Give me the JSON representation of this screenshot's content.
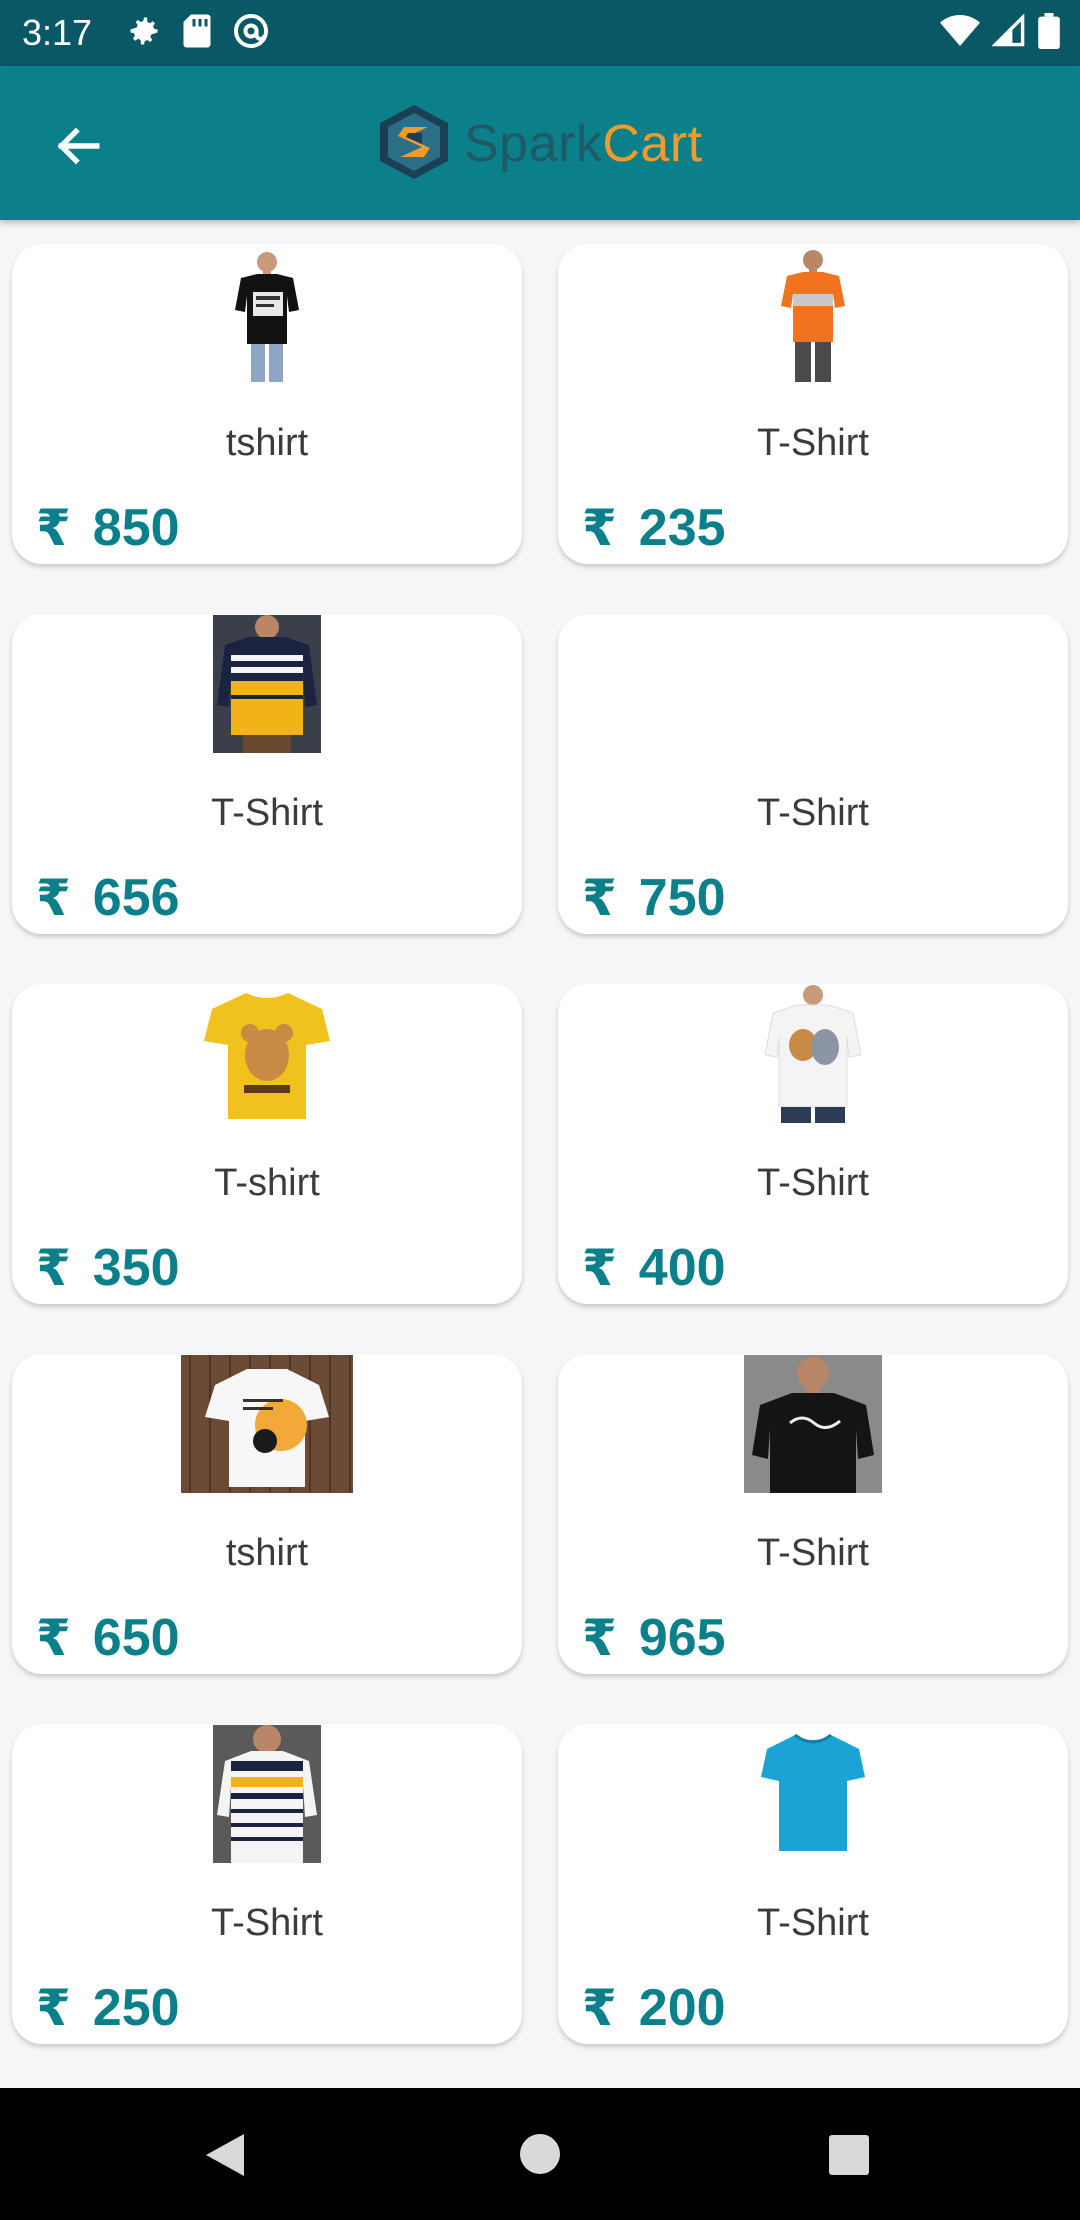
{
  "status_bar": {
    "time": "3:17",
    "left_icons": [
      "gear-icon",
      "sd-card-icon",
      "at-sign-icon"
    ],
    "right_icons": [
      "wifi-icon",
      "cell-signal-icon",
      "battery-icon"
    ]
  },
  "app_bar": {
    "back_icon": "arrow-left-icon",
    "logo_spark": "Spark",
    "logo_cart": "Cart",
    "colors": {
      "bar": "#0b7f8a",
      "status": "#0a5866",
      "spark": "#1e5a66",
      "cart": "#f29a2c"
    }
  },
  "currency_symbol": "₹",
  "products": [
    {
      "name": "tshirt",
      "price": "850",
      "image": "black-graphic-tshirt"
    },
    {
      "name": "T-Shirt",
      "price": "235",
      "image": "orange-grey-tshirt"
    },
    {
      "name": "T-Shirt",
      "price": "656",
      "image": "navy-yellow-striped-tshirt"
    },
    {
      "name": "T-Shirt",
      "price": "750",
      "image": ""
    },
    {
      "name": "T-shirt",
      "price": "350",
      "image": "yellow-jerry-tshirt"
    },
    {
      "name": "T-Shirt",
      "price": "400",
      "image": "white-tom-jerry-tshirt"
    },
    {
      "name": "tshirt",
      "price": "650",
      "image": "white-print-tshirt-on-wood"
    },
    {
      "name": "T-Shirt",
      "price": "965",
      "image": "black-script-tshirt"
    },
    {
      "name": "T-Shirt",
      "price": "250",
      "image": "white-navy-yellow-striped-polo"
    },
    {
      "name": "T-Shirt",
      "price": "200",
      "image": "blue-plain-tshirt"
    }
  ],
  "nav_bar": {
    "icons": [
      "nav-back-icon",
      "nav-home-icon",
      "nav-recent-icon"
    ]
  }
}
